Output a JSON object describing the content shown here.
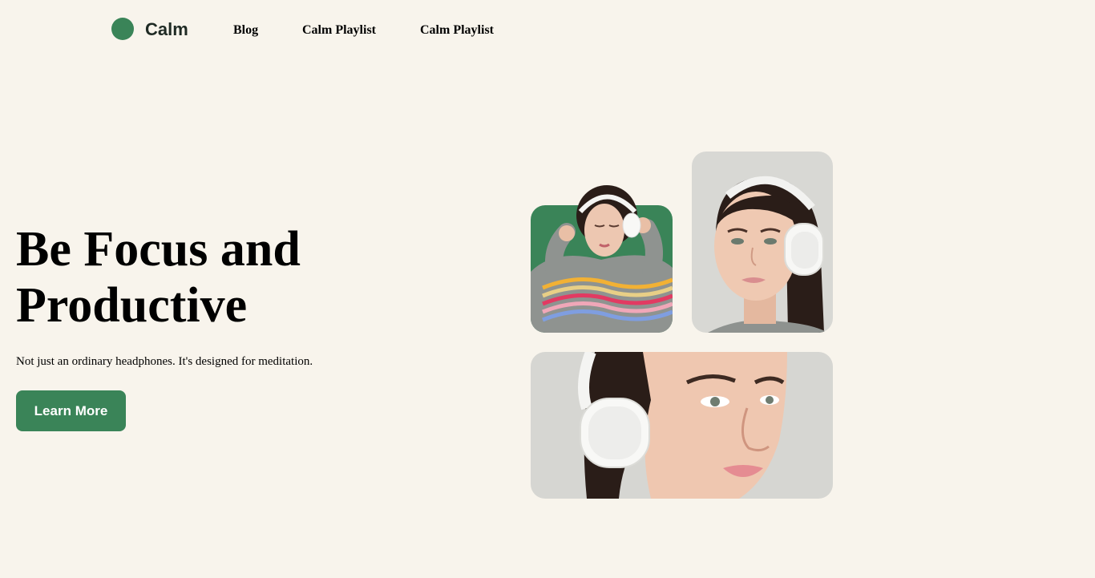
{
  "nav": {
    "brand": "Calm",
    "links": [
      {
        "label": "Blog"
      },
      {
        "label": "Calm Playlist"
      },
      {
        "label": "Calm Playlist"
      }
    ]
  },
  "hero": {
    "title_line1": "Be Focus and",
    "title_line2": "Productive",
    "subtitle": "Not just an ordinary headphones. It's designed for meditation.",
    "cta_label": "Learn More"
  },
  "images": [
    {
      "name": "woman-green-background-headphones"
    },
    {
      "name": "woman-grey-background-headphones-smiling"
    },
    {
      "name": "woman-closeup-headphones"
    }
  ],
  "colors": {
    "background": "#f8f4ec",
    "accent": "#3a8458",
    "text": "#000000",
    "photo_grey": "#d8d8d4"
  }
}
